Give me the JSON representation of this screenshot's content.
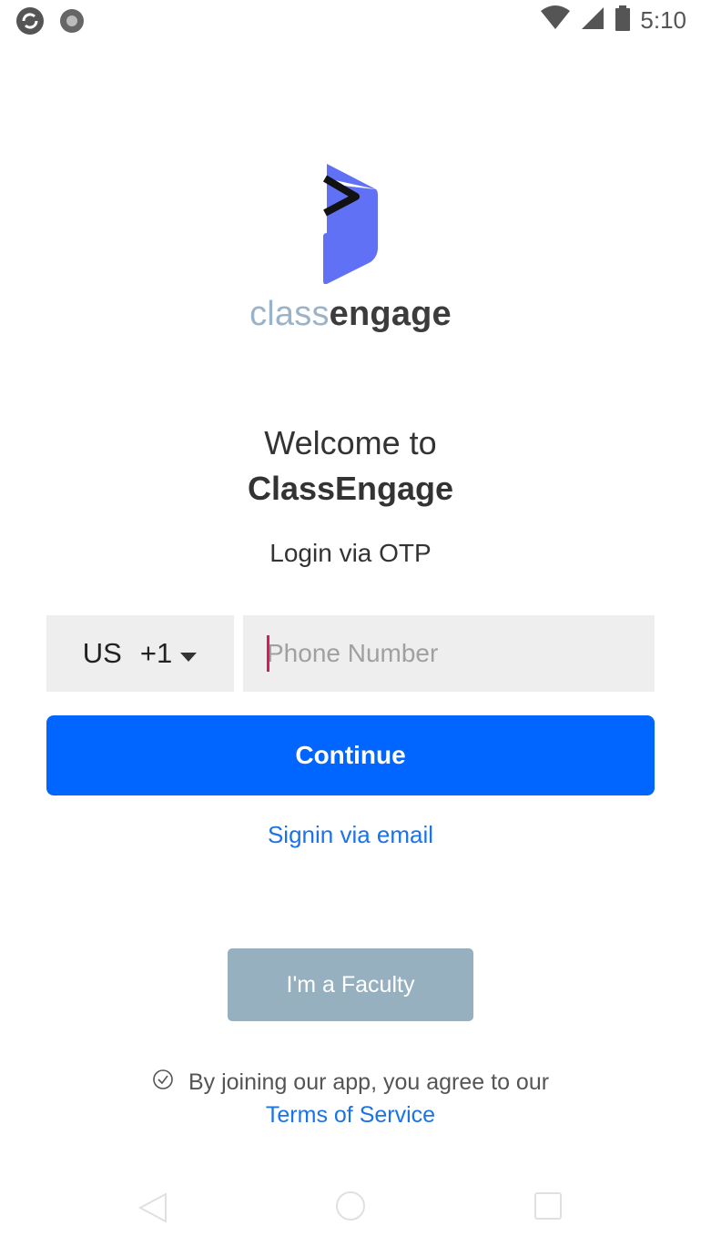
{
  "status_bar": {
    "time": "5:10"
  },
  "logo": {
    "brand_light": "class",
    "brand_bold": "engage"
  },
  "welcome": {
    "line1": "Welcome to",
    "app_name": "ClassEngage"
  },
  "subtitle": "Login via OTP",
  "form": {
    "country_code": "US",
    "dial_code": "+1",
    "phone_placeholder": "Phone Number",
    "phone_value": ""
  },
  "buttons": {
    "continue": "Continue",
    "signin_email": "Signin via email",
    "faculty": "I'm a Faculty"
  },
  "terms": {
    "text": "By joining our app, you agree to our",
    "link": "Terms of Service"
  },
  "colors": {
    "primary": "#0066ff",
    "link": "#1a73e8",
    "faculty": "#96b0bf",
    "logo": "#6171f5"
  }
}
